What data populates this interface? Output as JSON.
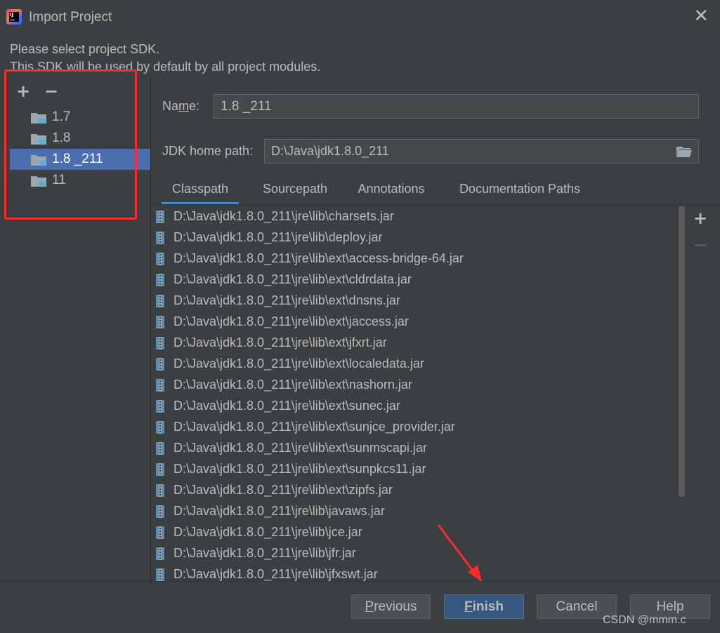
{
  "window": {
    "title": "Import Project",
    "close_glyph": "✕"
  },
  "description": {
    "line1": "Please select project SDK.",
    "line2": "This SDK will be used by default by all project modules."
  },
  "sdk_toolbar": {
    "add": "+",
    "remove": "−"
  },
  "sdk_list": [
    {
      "label": "1.7",
      "selected": false
    },
    {
      "label": "1.8",
      "selected": false
    },
    {
      "label": "1.8 _211",
      "selected": true
    },
    {
      "label": "11",
      "selected": false
    }
  ],
  "form": {
    "name_label_pre": "Na",
    "name_label_mnemonic": "m",
    "name_label_post": "e:",
    "name_value": "1.8 _211",
    "jdk_label": "JDK home path:",
    "jdk_value": "D:\\Java\\jdk1.8.0_211"
  },
  "tabs": [
    {
      "label": "Classpath",
      "active": true
    },
    {
      "label": "Sourcepath",
      "active": false
    },
    {
      "label": "Annotations",
      "active": false
    },
    {
      "label": "Documentation Paths",
      "active": false
    }
  ],
  "classpath": [
    "D:\\Java\\jdk1.8.0_211\\jre\\lib\\charsets.jar",
    "D:\\Java\\jdk1.8.0_211\\jre\\lib\\deploy.jar",
    "D:\\Java\\jdk1.8.0_211\\jre\\lib\\ext\\access-bridge-64.jar",
    "D:\\Java\\jdk1.8.0_211\\jre\\lib\\ext\\cldrdata.jar",
    "D:\\Java\\jdk1.8.0_211\\jre\\lib\\ext\\dnsns.jar",
    "D:\\Java\\jdk1.8.0_211\\jre\\lib\\ext\\jaccess.jar",
    "D:\\Java\\jdk1.8.0_211\\jre\\lib\\ext\\jfxrt.jar",
    "D:\\Java\\jdk1.8.0_211\\jre\\lib\\ext\\localedata.jar",
    "D:\\Java\\jdk1.8.0_211\\jre\\lib\\ext\\nashorn.jar",
    "D:\\Java\\jdk1.8.0_211\\jre\\lib\\ext\\sunec.jar",
    "D:\\Java\\jdk1.8.0_211\\jre\\lib\\ext\\sunjce_provider.jar",
    "D:\\Java\\jdk1.8.0_211\\jre\\lib\\ext\\sunmscapi.jar",
    "D:\\Java\\jdk1.8.0_211\\jre\\lib\\ext\\sunpkcs11.jar",
    "D:\\Java\\jdk1.8.0_211\\jre\\lib\\ext\\zipfs.jar",
    "D:\\Java\\jdk1.8.0_211\\jre\\lib\\javaws.jar",
    "D:\\Java\\jdk1.8.0_211\\jre\\lib\\jce.jar",
    "D:\\Java\\jdk1.8.0_211\\jre\\lib\\jfr.jar",
    "D:\\Java\\jdk1.8.0_211\\jre\\lib\\jfxswt.jar"
  ],
  "classpath_toolbar": {
    "add": "+",
    "remove": "−"
  },
  "buttons": {
    "previous_mnemonic": "P",
    "previous_rest": "revious",
    "finish_mnemonic": "F",
    "finish_rest": "inish",
    "cancel": "Cancel",
    "help": "Help"
  },
  "watermark": "CSDN @mmm.c",
  "colors": {
    "background": "#3c3f41",
    "selection": "#4b6eaf",
    "tab_underline": "#4a88c7",
    "highlight_box": "#ff2a2a",
    "default_button": "#365880",
    "folder_icon": "#9aa7b0",
    "jdk_badge": "#40b6e0"
  },
  "icons": {
    "app": "intellij-idea-icon",
    "sdk_item": "jdk-folder-icon",
    "classpath_item": "jar-archive-icon",
    "browse": "open-folder-icon"
  }
}
